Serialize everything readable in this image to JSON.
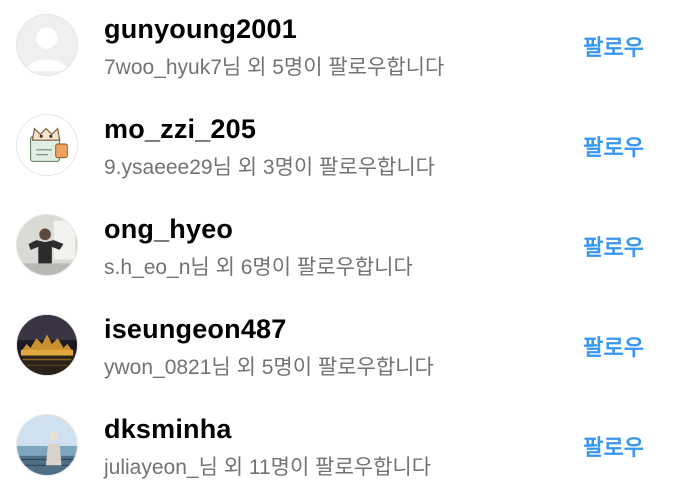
{
  "accent_color": "#3897f0",
  "follow_label": "팔로우",
  "suggestions": [
    {
      "username": "gunyoung2001",
      "subtitle": "7woo_hyuk7님 외 5명이 팔로우합니다",
      "avatar": "default-avatar-icon"
    },
    {
      "username": "mo_zzi_205",
      "subtitle": "9.ysaeee29님 외 3명이 팔로우합니다",
      "avatar": "cartoon-cat-avatar"
    },
    {
      "username": "ong_hyeo",
      "subtitle": "s.h_eo_n님 외 6명이 팔로우합니다",
      "avatar": "person-photo-avatar"
    },
    {
      "username": "iseungeon487",
      "subtitle": "ywon_0821님 외 5명이 팔로우합니다",
      "avatar": "night-city-avatar"
    },
    {
      "username": "dksminha",
      "subtitle": "juliayeon_님 외 11명이 팔로우합니다",
      "avatar": "seaside-photo-avatar"
    }
  ]
}
